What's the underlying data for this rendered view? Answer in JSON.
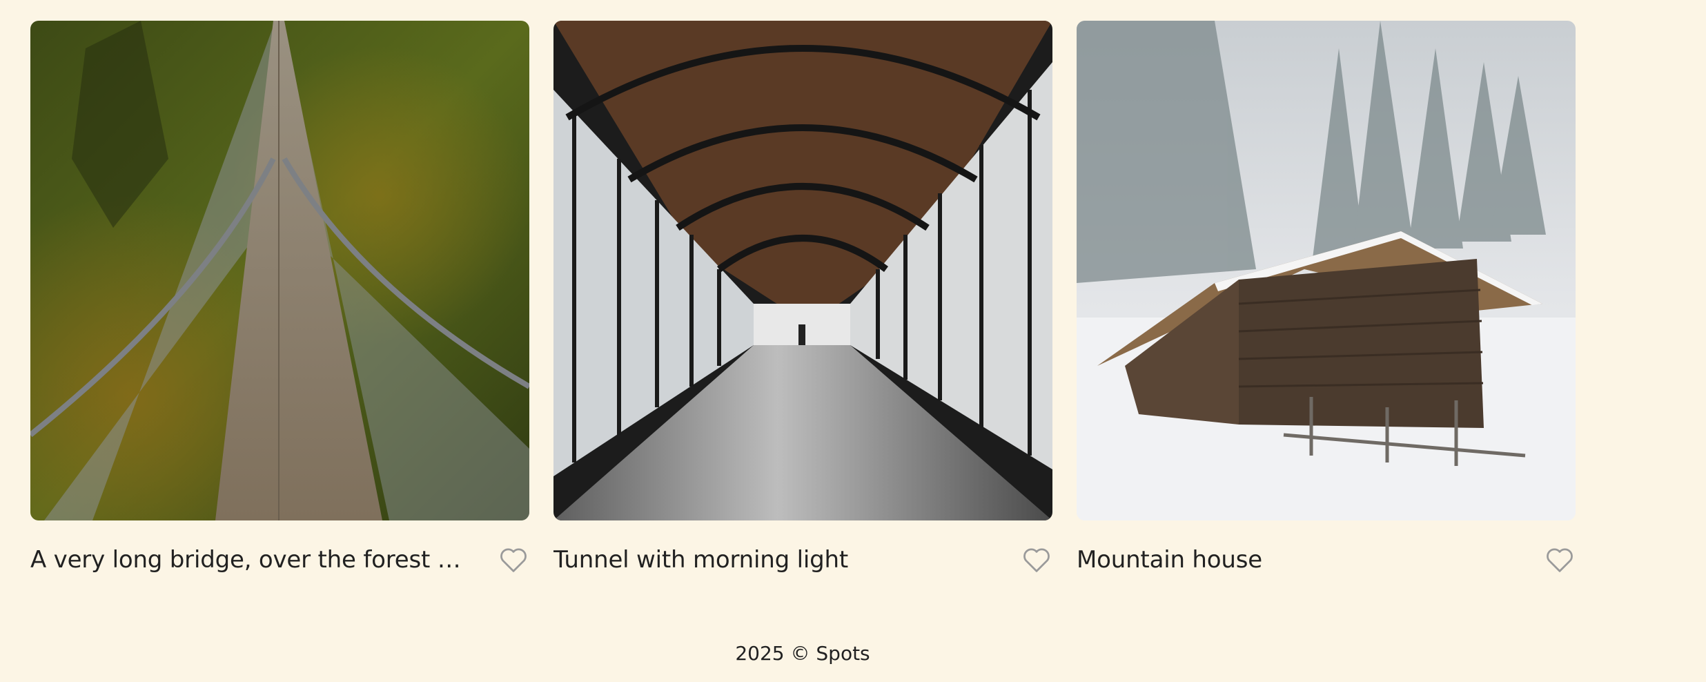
{
  "cards": [
    {
      "title": "A very long bridge, over the forest a...",
      "image_alt": "bridge",
      "liked": false
    },
    {
      "title": "Tunnel with morning light",
      "image_alt": "tunnel",
      "liked": false
    },
    {
      "title": "Mountain house",
      "image_alt": "house",
      "liked": false
    }
  ],
  "footer": {
    "text": "2025 © Spots"
  },
  "colors": {
    "background": "#fcf5e5",
    "text": "#212121",
    "heart_outline": "#9a9a9a"
  }
}
